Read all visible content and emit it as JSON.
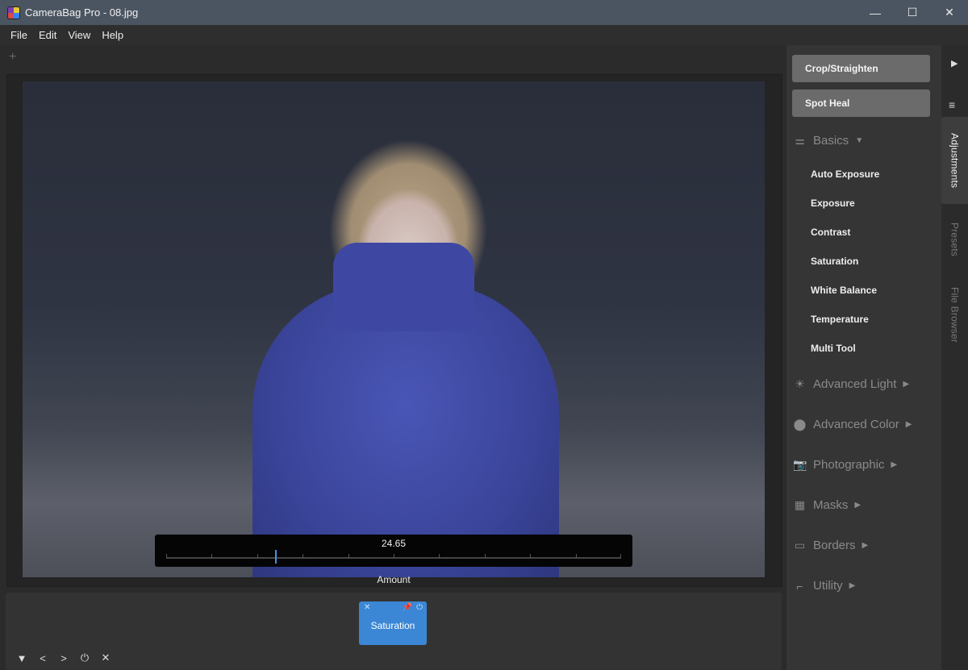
{
  "window": {
    "title": "CameraBag Pro - 08.jpg",
    "minimize": "—",
    "maximize": "☐",
    "close": "✕"
  },
  "menu": [
    "File",
    "Edit",
    "View",
    "Help"
  ],
  "toolbar": {
    "add": "+"
  },
  "slider": {
    "value": "24.65",
    "label": "Amount",
    "level": 0.24
  },
  "adjustment_chip": {
    "label": "Saturation",
    "close": "✕",
    "pin": "📌",
    "power": "⏻"
  },
  "bottom_controls": [
    "▼",
    "<",
    ">",
    "⏻",
    "✕"
  ],
  "right_panel": {
    "crop_button": "Crop/Straighten",
    "spot_heal_button": "Spot Heal",
    "basics": {
      "label": "Basics",
      "icon": "sliders-icon",
      "items": [
        "Auto Exposure",
        "Exposure",
        "Contrast",
        "Saturation",
        "White Balance",
        "Temperature",
        "Multi Tool"
      ]
    },
    "sections": [
      {
        "label": "Advanced Light",
        "icon": "sun-icon",
        "glyph": "☀"
      },
      {
        "label": "Advanced Color",
        "icon": "color-circles-icon",
        "glyph": "⬤"
      },
      {
        "label": "Photographic",
        "icon": "camera-icon",
        "glyph": "📷"
      },
      {
        "label": "Masks",
        "icon": "checker-icon",
        "glyph": "▦"
      },
      {
        "label": "Borders",
        "icon": "border-icon",
        "glyph": "▭"
      },
      {
        "label": "Utility",
        "icon": "utility-icon",
        "glyph": "⌐"
      }
    ]
  },
  "tabs": {
    "adjustments": "Adjustments",
    "presets": "Presets",
    "file_browser": "File Browser"
  }
}
